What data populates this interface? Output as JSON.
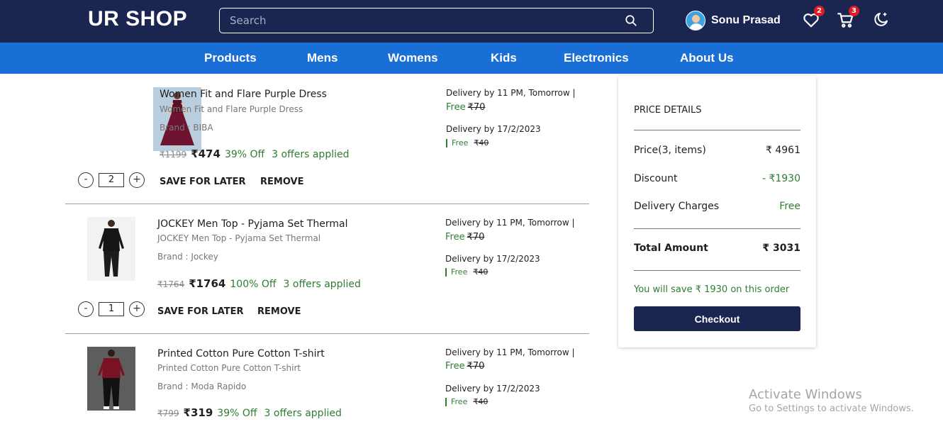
{
  "header": {
    "logo": "UR SHOP",
    "search_placeholder": "Search",
    "username": "Sonu Prasad",
    "wishlist_count": "2",
    "cart_count": "3",
    "icons": [
      "search-icon",
      "heart-icon",
      "cart-icon",
      "moon-icon"
    ]
  },
  "nav": [
    "Products",
    "Mens",
    "Womens",
    "Kids",
    "Electronics",
    "About Us"
  ],
  "items": [
    {
      "title": "Women Fit and Flare Purple Dress",
      "subtitle": "Women Fit and Flare Purple Dress",
      "brand": "Brand : BIBA",
      "original_price": "₹1199",
      "price": "₹474",
      "discount": "39% Off",
      "offers": "3 offers applied",
      "quantity": "2",
      "delivery1": "Delivery by 11 PM, Tomorrow |",
      "free1": "Free",
      "strike1": "₹70",
      "delivery2": "Delivery by 17/2/2023",
      "free2": "Free",
      "strike2": "₹40"
    },
    {
      "title": "JOCKEY Men Top - Pyjama Set Thermal",
      "subtitle": "JOCKEY Men Top - Pyjama Set Thermal",
      "brand": "Brand : Jockey",
      "original_price": "₹1764",
      "price": "₹1764",
      "discount": "100% Off",
      "offers": "3 offers applied",
      "quantity": "1",
      "delivery1": "Delivery by 11 PM, Tomorrow |",
      "free1": "Free",
      "strike1": "₹70",
      "delivery2": "Delivery by 17/2/2023",
      "free2": "Free",
      "strike2": "₹40"
    },
    {
      "title": "Printed Cotton Pure Cotton T-shirt",
      "subtitle": "Printed Cotton Pure Cotton T-shirt",
      "brand": "Brand : Moda Rapido",
      "original_price": "₹799",
      "price": "₹319",
      "discount": "39% Off",
      "offers": "3 offers applied",
      "delivery1": "Delivery by 11 PM, Tomorrow |",
      "free1": "Free",
      "strike1": "₹70",
      "delivery2": "Delivery by 17/2/2023",
      "free2": "Free",
      "strike2": "₹40"
    }
  ],
  "actions": {
    "save_for_later": "SAVE FOR LATER",
    "remove": "REMOVE",
    "minus": "-",
    "plus": "+"
  },
  "price_details": {
    "heading": "PRICE DETAILS",
    "price_label": "Price(3, items)",
    "price_value": "₹ 4961",
    "discount_label": "Discount",
    "discount_value": "- ₹1930",
    "delivery_label": "Delivery Charges",
    "delivery_value": "Free",
    "total_label": "Total Amount",
    "total_value": "₹ 3031",
    "save_note": "You will save ₹ 1930 on this order",
    "checkout": "Checkout"
  },
  "watermark": {
    "title": "Activate Windows",
    "subtitle": "Go to Settings to activate Windows."
  },
  "colors": {
    "header_bg": "#1a2550",
    "nav_bg": "#1a6fd6",
    "accent_green": "#2e7d32",
    "badge_red": "#e01b24"
  }
}
